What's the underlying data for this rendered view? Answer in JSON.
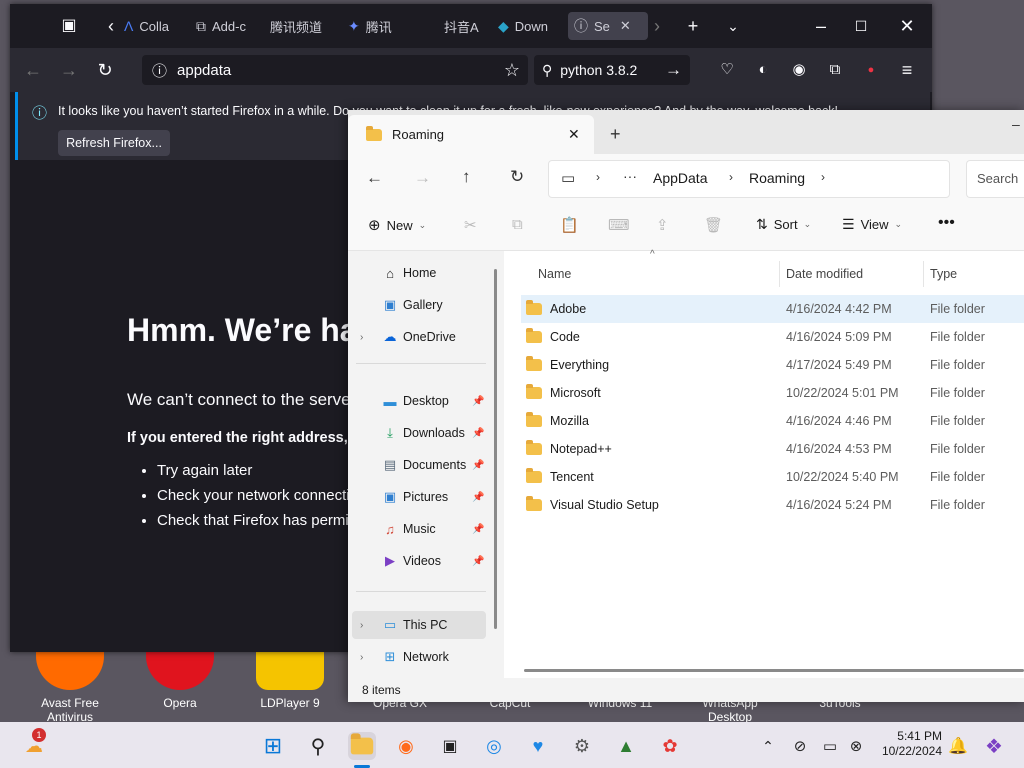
{
  "desktop": {
    "icons": [
      {
        "label": "Avast Free Antivirus",
        "color": "#ff6a00"
      },
      {
        "label": "Opera",
        "color": "#e0141e"
      },
      {
        "label": "LDPlayer 9",
        "color": "#f5c400"
      },
      {
        "label": "Opera GX",
        "color": "#333"
      },
      {
        "label": "CapCut",
        "color": "#222"
      },
      {
        "label": "Windows 11",
        "color": "#3a7bd5"
      },
      {
        "label": "WhatsApp Desktop",
        "color": "#25d366"
      },
      {
        "label": "3uTools",
        "color": "#2a6fdb"
      }
    ]
  },
  "firefox": {
    "tabs": [
      {
        "label": "Colla",
        "icon": "colla-icon"
      },
      {
        "label": "Add-c",
        "icon": "puzzle-icon"
      },
      {
        "label": "腾讯频道",
        "icon": ""
      },
      {
        "label": "腾讯",
        "icon": "tencent-icon"
      },
      {
        "label": "抖音A",
        "icon": ""
      },
      {
        "label": "Down",
        "icon": "download-icon"
      },
      {
        "label": "Se",
        "icon": "info-icon"
      }
    ],
    "url": "appdata",
    "search": "python 3.8.2",
    "notification": {
      "text": "It looks like you haven’t started Firefox in a while. Do you want to clean it up for a fresh, like-new experience? And by the way, welcome back!",
      "button": "Refresh Firefox..."
    },
    "error": {
      "title": "Hmm. We’re having trouble finding that site.",
      "subtitle": "We can’t connect to the server at appdata.",
      "hint": "If you entered the right address, you can:",
      "items": [
        "Try again later",
        "Check your network connection",
        "Check that Firefox has permission to access the web"
      ]
    }
  },
  "explorer": {
    "tab_title": "Roaming",
    "breadcrumb": [
      "AppData",
      "Roaming"
    ],
    "search_placeholder": "Search",
    "toolbar": {
      "new": "New",
      "sort": "Sort",
      "view": "View"
    },
    "sidebar": [
      {
        "label": "Home",
        "icon": "home-icon"
      },
      {
        "label": "Gallery",
        "icon": "gallery-icon"
      },
      {
        "label": "OneDrive",
        "icon": "cloud-icon"
      },
      {
        "label": "Desktop",
        "icon": "desktop-icon"
      },
      {
        "label": "Downloads",
        "icon": "download-icon"
      },
      {
        "label": "Documents",
        "icon": "documents-icon"
      },
      {
        "label": "Pictures",
        "icon": "pictures-icon"
      },
      {
        "label": "Music",
        "icon": "music-icon"
      },
      {
        "label": "Videos",
        "icon": "videos-icon"
      },
      {
        "label": "This PC",
        "icon": "pc-icon"
      },
      {
        "label": "Network",
        "icon": "network-icon"
      }
    ],
    "columns": {
      "name": "Name",
      "date": "Date modified",
      "type": "Type"
    },
    "files": [
      {
        "name": "Adobe",
        "date": "4/16/2024 4:42 PM",
        "type": "File folder"
      },
      {
        "name": "Code",
        "date": "4/16/2024 5:09 PM",
        "type": "File folder"
      },
      {
        "name": "Everything",
        "date": "4/17/2024 5:49 PM",
        "type": "File folder"
      },
      {
        "name": "Microsoft",
        "date": "10/22/2024 5:01 PM",
        "type": "File folder"
      },
      {
        "name": "Mozilla",
        "date": "4/16/2024 4:46 PM",
        "type": "File folder"
      },
      {
        "name": "Notepad++",
        "date": "4/16/2024 4:53 PM",
        "type": "File folder"
      },
      {
        "name": "Tencent",
        "date": "10/22/2024 5:40 PM",
        "type": "File folder"
      },
      {
        "name": "Visual Studio Setup",
        "date": "4/16/2024 5:24 PM",
        "type": "File folder"
      }
    ],
    "status": "8 items"
  },
  "taskbar": {
    "time": "5:41 PM",
    "date": "10/22/2024",
    "weather_badge": "1"
  }
}
